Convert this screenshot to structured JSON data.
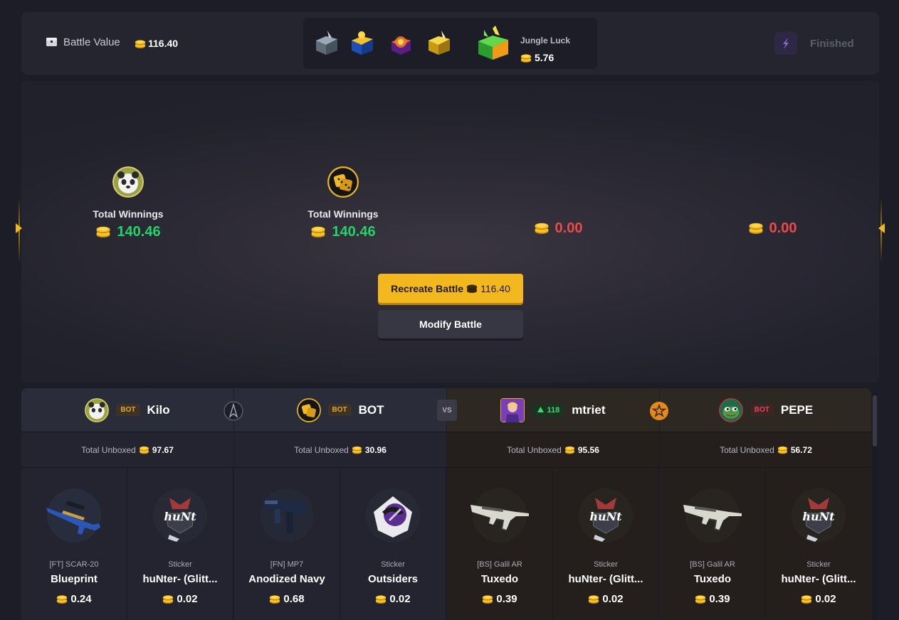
{
  "header": {
    "battle_value_label": "Battle Value",
    "battle_value": "116.40",
    "case_name": "Jungle Luck",
    "case_price": "5.76",
    "status": "Finished"
  },
  "arena": {
    "players": [
      {
        "label": "Total Winnings",
        "amount": "140.46",
        "color": "#22d36b"
      },
      {
        "label": "Total Winnings",
        "amount": "140.46",
        "color": "#22d36b"
      },
      {
        "label": "",
        "amount": "0.00",
        "color": "#ef4a4a"
      },
      {
        "label": "",
        "amount": "0.00",
        "color": "#ef4a4a"
      }
    ],
    "recreate_label": "Recreate Battle",
    "recreate_price": "116.40",
    "modify_label": "Modify Battle"
  },
  "players": [
    {
      "name": "Kilo",
      "badge": "BOT",
      "total_label": "Total Unboxed",
      "total": "97.67",
      "items": [
        {
          "condition": "[FT] SCAR-20",
          "name": "Blueprint",
          "price": "0.24"
        },
        {
          "condition": "Sticker",
          "name": "huNter- (Glitt...",
          "price": "0.02"
        }
      ]
    },
    {
      "name": "BOT",
      "badge": "BOT",
      "total_label": "Total Unboxed",
      "total": "30.96",
      "items": [
        {
          "condition": "[FN] MP7",
          "name": "Anodized Navy",
          "price": "0.68"
        },
        {
          "condition": "Sticker",
          "name": "Outsiders",
          "price": "0.02"
        }
      ]
    },
    {
      "name": "mtriet",
      "badge": "118",
      "total_label": "Total Unboxed",
      "total": "95.56",
      "items": [
        {
          "condition": "[BS] Galil AR",
          "name": "Tuxedo",
          "price": "0.39"
        },
        {
          "condition": "Sticker",
          "name": "huNter- (Glitt...",
          "price": "0.02"
        }
      ]
    },
    {
      "name": "PEPE",
      "badge": "BOT",
      "total_label": "Total Unboxed",
      "total": "56.72",
      "items": [
        {
          "condition": "[BS] Galil AR",
          "name": "Tuxedo",
          "price": "0.39"
        },
        {
          "condition": "Sticker",
          "name": "huNter- (Glitt...",
          "price": "0.02"
        }
      ]
    }
  ],
  "vs_label": "VS",
  "colors": {
    "accent": "#f3b81d",
    "win": "#22d36b",
    "loss": "#ef4a4a"
  }
}
